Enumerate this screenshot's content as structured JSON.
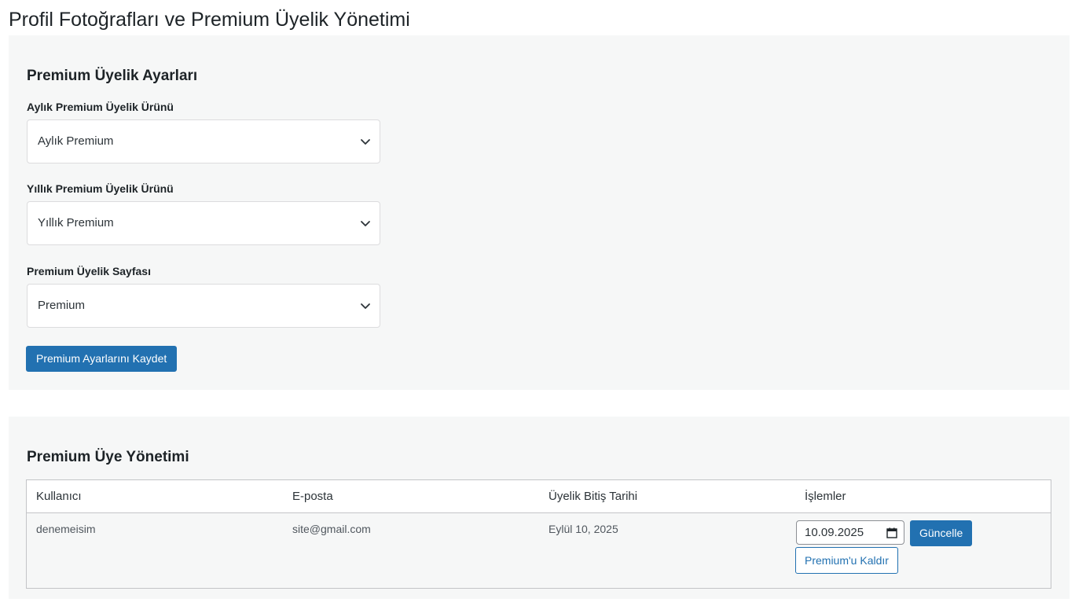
{
  "page": {
    "title": "Profil Fotoğrafları ve Premium Üyelik Yönetimi"
  },
  "settings": {
    "section_title": "Premium Üyelik Ayarları",
    "monthly": {
      "label": "Aylık Premium Üyelik Ürünü",
      "selected": "Aylık Premium"
    },
    "yearly": {
      "label": "Yıllık Premium Üyelik Ürünü",
      "selected": "Yıllık Premium"
    },
    "page": {
      "label": "Premium Üyelik Sayfası",
      "selected": "Premium"
    },
    "save_label": "Premium Ayarlarını Kaydet"
  },
  "members": {
    "section_title": "Premium Üye Yönetimi",
    "columns": [
      "Kullanıcı",
      "E-posta",
      "Üyelik Bitiş Tarihi",
      "İşlemler"
    ],
    "rows": [
      {
        "user": "denemeisim",
        "email": "site@gmail.com",
        "expiry": "Eylül 10, 2025",
        "date_value": "10.09.2025",
        "update_label": "Güncelle",
        "remove_label": "Premium'u Kaldır"
      }
    ]
  },
  "colors": {
    "accent": "#2271b1",
    "panel_bg": "#f6f7f7",
    "text": "#1d2327"
  }
}
